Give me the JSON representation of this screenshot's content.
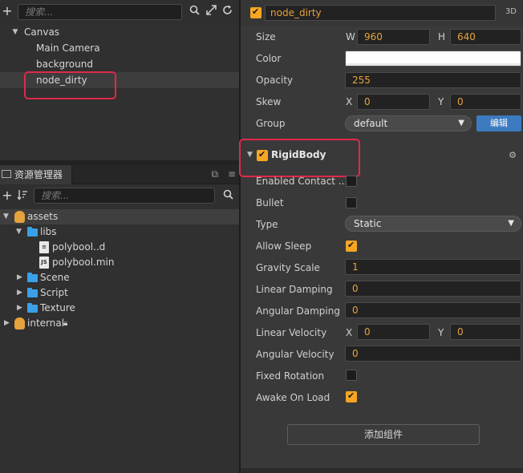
{
  "hierarchy": {
    "search_placeholder": "搜索...",
    "toolbar_icons": [
      "plus-icon",
      "search-icon",
      "expand-icon",
      "refresh-icon"
    ],
    "nodes": [
      {
        "label": "Canvas",
        "expanded": true
      },
      {
        "label": "Main Camera"
      },
      {
        "label": "background"
      },
      {
        "label": "node_dirty",
        "selected": true
      }
    ]
  },
  "assets": {
    "tab_title": "资源管理器",
    "search_placeholder": "搜索...",
    "items": [
      {
        "label": "assets",
        "type": "db",
        "expanded": true
      },
      {
        "label": "libs",
        "type": "folder",
        "expanded": true
      },
      {
        "label": "polybool..d",
        "type": "file"
      },
      {
        "label": "polybool.min",
        "type": "js"
      },
      {
        "label": "Scene",
        "type": "folder"
      },
      {
        "label": "Script",
        "type": "folder"
      },
      {
        "label": "Texture",
        "type": "folder"
      },
      {
        "label": "internal",
        "type": "db",
        "locked": true
      }
    ]
  },
  "inspector": {
    "node_name": "node_dirty",
    "node_active": true,
    "mode_label": "3D",
    "props": {
      "size_label": "Size",
      "w_label": "W",
      "w_value": "960",
      "h_label": "H",
      "h_value": "640",
      "color_label": "Color",
      "color_value": "#ffffff",
      "opacity_label": "Opacity",
      "opacity_value": "255",
      "skew_label": "Skew",
      "skew_x_label": "X",
      "skew_x_value": "0",
      "skew_y_label": "Y",
      "skew_y_value": "0",
      "group_label": "Group",
      "group_value": "default",
      "group_edit_label": "编辑"
    },
    "component": {
      "title": "RigidBody",
      "enabled": true,
      "enabled_contact_label": "Enabled Contact ...",
      "enabled_contact": false,
      "bullet_label": "Bullet",
      "bullet": false,
      "type_label": "Type",
      "type_value": "Static",
      "allow_sleep_label": "Allow Sleep",
      "allow_sleep": true,
      "gravity_scale_label": "Gravity Scale",
      "gravity_scale": "1",
      "linear_damping_label": "Linear Damping",
      "linear_damping": "0",
      "angular_damping_label": "Angular Damping",
      "angular_damping": "0",
      "linear_velocity_label": "Linear Velocity",
      "lv_x_label": "X",
      "lv_x": "0",
      "lv_y_label": "Y",
      "lv_y": "0",
      "angular_velocity_label": "Angular Velocity",
      "angular_velocity": "0",
      "fixed_rotation_label": "Fixed Rotation",
      "fixed_rotation": false,
      "awake_on_load_label": "Awake On Load",
      "awake_on_load": true
    },
    "add_component_label": "添加组件"
  },
  "colors": {
    "accent_orange": "#e6a23c",
    "highlight_red": "#e0294a",
    "button_blue": "#3d7bc0",
    "folder_blue": "#3aa0e8"
  }
}
